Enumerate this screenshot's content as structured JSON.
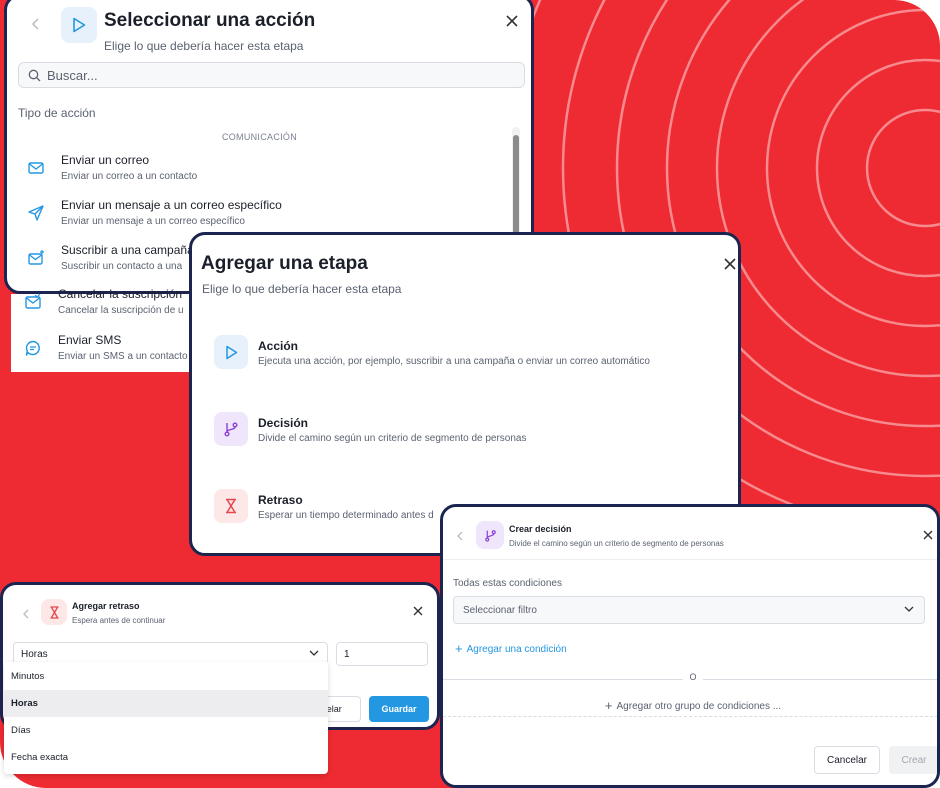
{
  "colors": {
    "background": "#ee2b32",
    "panel_border": "#1c2450",
    "accent_blue": "#2497e3",
    "decision_purple": "#8b3fd9",
    "delay_red": "#e5484d"
  },
  "select_action": {
    "title": "Seleccionar una acción",
    "subtitle": "Elige lo que debería hacer esta etapa",
    "search_placeholder": "Buscar...",
    "section_label": "Tipo de acción",
    "category": "COMUNICACIÓN",
    "items": [
      {
        "name": "Enviar un correo",
        "desc": "Enviar un correo a un contacto",
        "icon": "mail-icon"
      },
      {
        "name": "Enviar un mensaje a un correo específico",
        "desc": "Enviar un mensaje a un correo específico",
        "icon": "send-icon"
      },
      {
        "name": "Suscribir a una campaña",
        "desc": "Suscribir un contacto a una",
        "icon": "mail-add-icon"
      },
      {
        "name": "Cancelar la suscripción",
        "desc": "Cancelar la suscripción de u",
        "icon": "mail-check-icon"
      },
      {
        "name": "Enviar SMS",
        "desc": "Enviar un SMS a un contacto",
        "icon": "sms-icon"
      }
    ]
  },
  "add_stage": {
    "title": "Agregar una etapa",
    "subtitle": "Elige lo que debería hacer esta etapa",
    "options": [
      {
        "name": "Acción",
        "desc": "Ejecuta una acción, por ejemplo, suscribir a una campaña o enviar un correo automático",
        "icon": "play-icon"
      },
      {
        "name": "Decisión",
        "desc": "Divide el camino según un criterio de segmento de personas",
        "icon": "branch-icon"
      },
      {
        "name": "Retraso",
        "desc": "Esperar un tiempo determinado antes d",
        "icon": "hourglass-icon"
      }
    ]
  },
  "add_delay": {
    "title": "Agregar retraso",
    "subtitle": "Espera antes de continuar",
    "unit_selected": "Horas",
    "amount": "1",
    "cancel_label": "Cancelar",
    "cancel_visible": "celar",
    "save_label": "Guardar",
    "unit_options": [
      "Minutos",
      "Horas",
      "Días",
      "Fecha exacta"
    ],
    "selected_index": 1
  },
  "create_decision": {
    "title": "Crear decisión",
    "subtitle": "Divide el camino según un criterio de segmento de personas",
    "conditions_label": "Todas estas condiciones",
    "filter_placeholder": "Seleccionar filtro",
    "add_condition": "Agregar una condición",
    "or_label": "O",
    "add_group": "Agregar otro grupo de condiciones ...",
    "cancel_label": "Cancelar",
    "create_label": "Crear"
  }
}
